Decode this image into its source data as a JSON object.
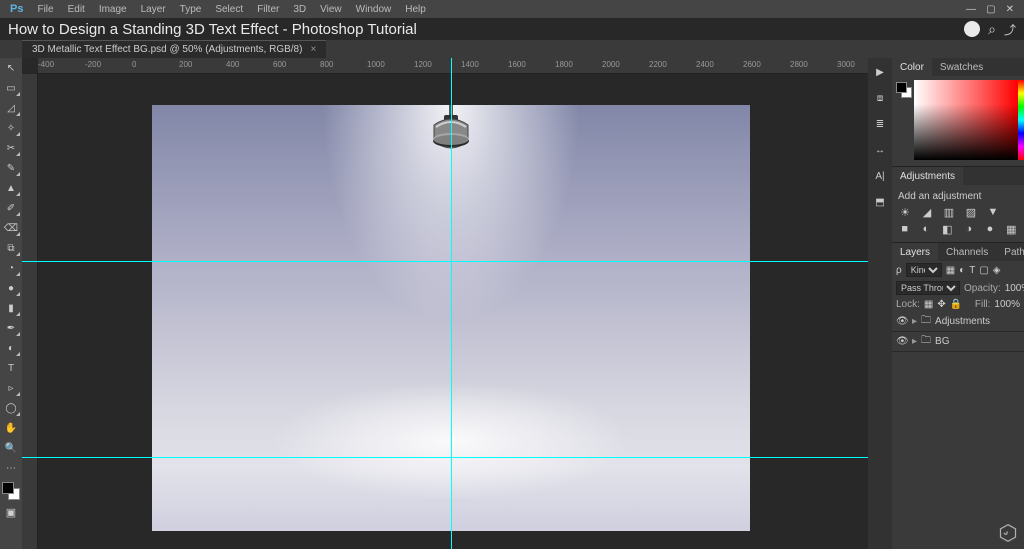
{
  "menu": {
    "logo": "Ps",
    "items": [
      "File",
      "Edit",
      "Image",
      "Layer",
      "Type",
      "Select",
      "Filter",
      "3D",
      "View",
      "Window",
      "Help"
    ]
  },
  "title": "How to Design a Standing 3D Text Effect - Photoshop Tutorial",
  "doc_tab": "3D Metallic Text Effect BG.psd @ 50% (Adjustments, RGB/8)",
  "ruler_marks": [
    "-400",
    "-200",
    "0",
    "200",
    "400",
    "600",
    "800",
    "1000",
    "1200",
    "1400",
    "1600",
    "1800",
    "2000",
    "2200",
    "2400",
    "2600",
    "2800",
    "3000"
  ],
  "panels": {
    "color": {
      "tabs": [
        "Color",
        "Swatches"
      ],
      "active": 0
    },
    "adjust": {
      "tab": "Adjustments",
      "label": "Add an adjustment",
      "row1": [
        "☀",
        "◢",
        "▥",
        "▨",
        "▼"
      ],
      "row2": [
        "■",
        "◐",
        "◧",
        "◑",
        "●",
        "▦"
      ]
    },
    "layers": {
      "tabs": [
        "Layers",
        "Channels",
        "Paths"
      ],
      "active": 0,
      "kind": "Kind",
      "blend": "Pass Through",
      "opacity_label": "Opacity:",
      "opacity": "100%",
      "lock_label": "Lock:",
      "fill_label": "Fill:",
      "fill": "100%",
      "items": [
        {
          "name": "Adjustments"
        },
        {
          "name": "BG"
        }
      ]
    }
  },
  "tools": [
    "↖",
    "▭",
    "◿",
    "✧",
    "✂",
    "✎",
    "▲",
    "✐",
    "⌫",
    "⧉",
    "◔",
    "●",
    "▮",
    "✒",
    "◐",
    "⊹",
    "T",
    "▹",
    "◯",
    "✋",
    "🔍",
    "⋯"
  ],
  "sidetools": [
    "▶",
    "⧈",
    "≣",
    "↔",
    "A|",
    "⬒"
  ]
}
